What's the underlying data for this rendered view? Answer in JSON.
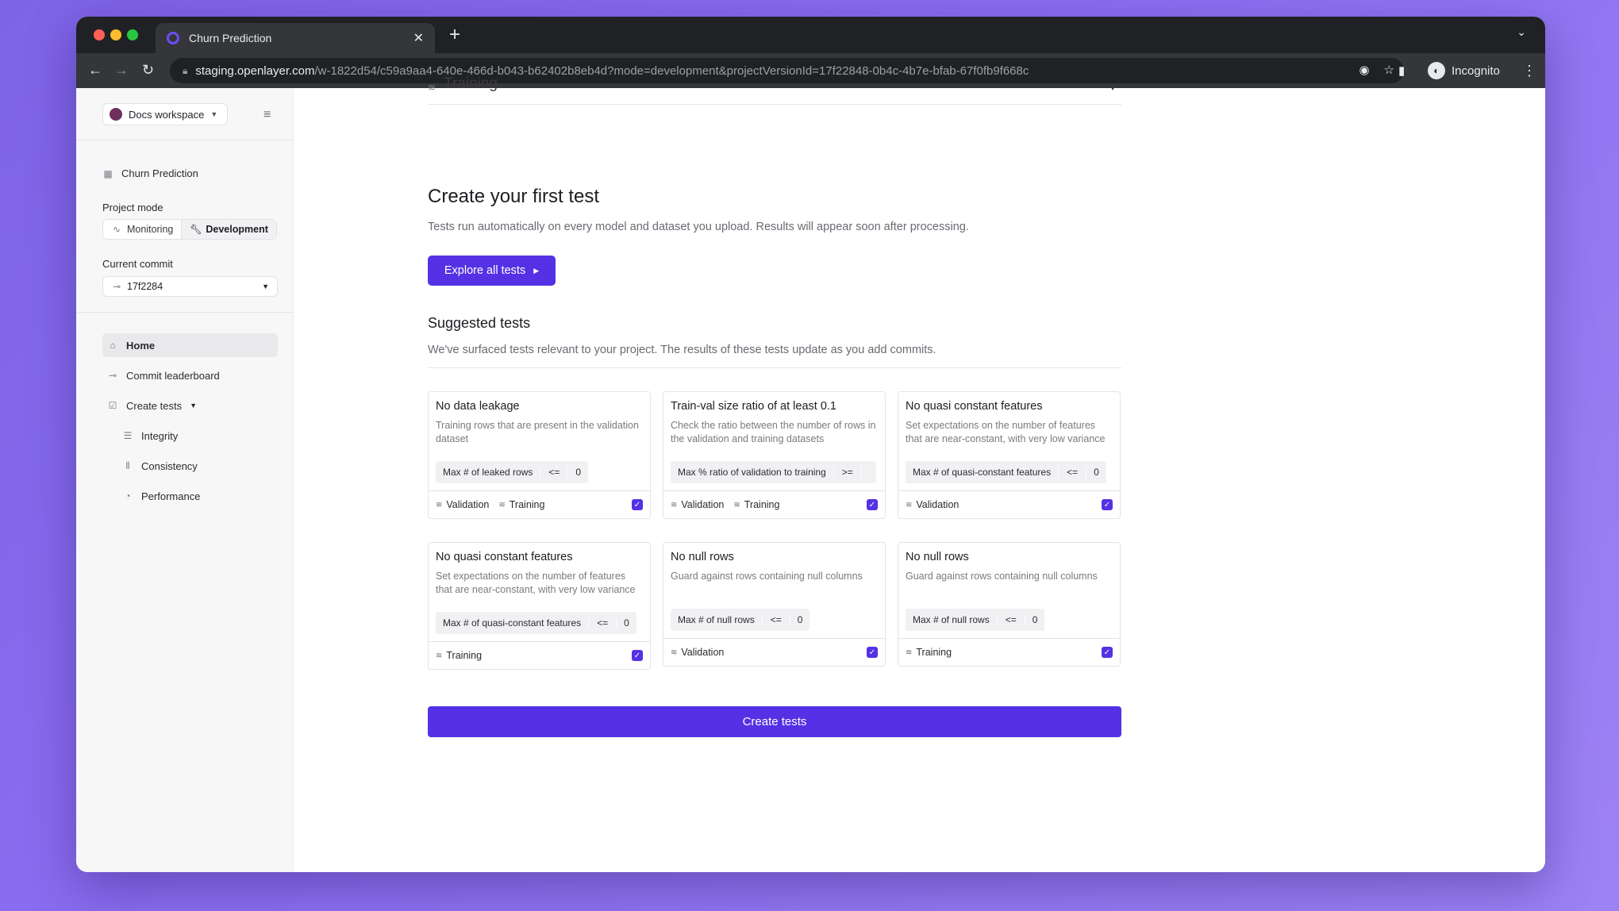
{
  "browser": {
    "tab_title": "Churn Prediction",
    "url_host": "staging.openlayer.com",
    "url_path": "/w-1822d54/c59a9aa4-640e-466d-b043-b62402b8eb4d?mode=development&projectVersionId=17f22848-0b4c-4b7e-bfab-67f0fb9f668c",
    "profile": "Incognito"
  },
  "sidebar": {
    "workspace": "Docs workspace",
    "project": "Churn Prediction",
    "project_mode_label": "Project mode",
    "modes": [
      "Monitoring",
      "Development"
    ],
    "current_commit_label": "Current commit",
    "commit": "17f2284",
    "nav": {
      "home": "Home",
      "leaderboard": "Commit leaderboard",
      "create_tests": "Create tests",
      "integrity": "Integrity",
      "consistency": "Consistency",
      "performance": "Performance"
    }
  },
  "main": {
    "section_header": "Training",
    "heading": "Create your first test",
    "subheading": "Tests run automatically on every model and dataset you upload. Results will appear soon after processing.",
    "explore_button": "Explore all tests",
    "suggested_title": "Suggested tests",
    "suggested_desc": "We've surfaced tests relevant to your project. The results of these tests update as you add commits.",
    "create_button": "Create tests",
    "cards": [
      {
        "title": "No data leakage",
        "desc": "Training rows that are present in the validation dataset",
        "metric": "Max # of leaked rows",
        "op": "<=",
        "value": "0",
        "tags": [
          "Validation",
          "Training"
        ]
      },
      {
        "title": "Train-val size ratio of at least 0.1",
        "desc": "Check the ratio between the number of rows in the validation and training datasets",
        "metric": "Max % ratio of validation to training",
        "op": ">=",
        "value": "",
        "tags": [
          "Validation",
          "Training"
        ]
      },
      {
        "title": "No quasi constant features",
        "desc": "Set expectations on the number of features that are near-constant, with very low variance",
        "metric": "Max # of quasi-constant features",
        "op": "<=",
        "value": "0",
        "tags": [
          "Validation"
        ]
      },
      {
        "title": "No quasi constant features",
        "desc": "Set expectations on the number of features that are near-constant, with very low variance",
        "metric": "Max # of quasi-constant features",
        "op": "<=",
        "value": "0",
        "tags": [
          "Training"
        ]
      },
      {
        "title": "No null rows",
        "desc": "Guard against rows containing null columns",
        "metric": "Max # of null rows",
        "op": "<=",
        "value": "0",
        "tags": [
          "Validation"
        ]
      },
      {
        "title": "No null rows",
        "desc": "Guard against rows containing null columns",
        "metric": "Max # of null rows",
        "op": "<=",
        "value": "0",
        "tags": [
          "Training"
        ]
      }
    ]
  },
  "colors": {
    "accent": "#5431e4",
    "sidebar_bg": "#f7f7f8"
  }
}
